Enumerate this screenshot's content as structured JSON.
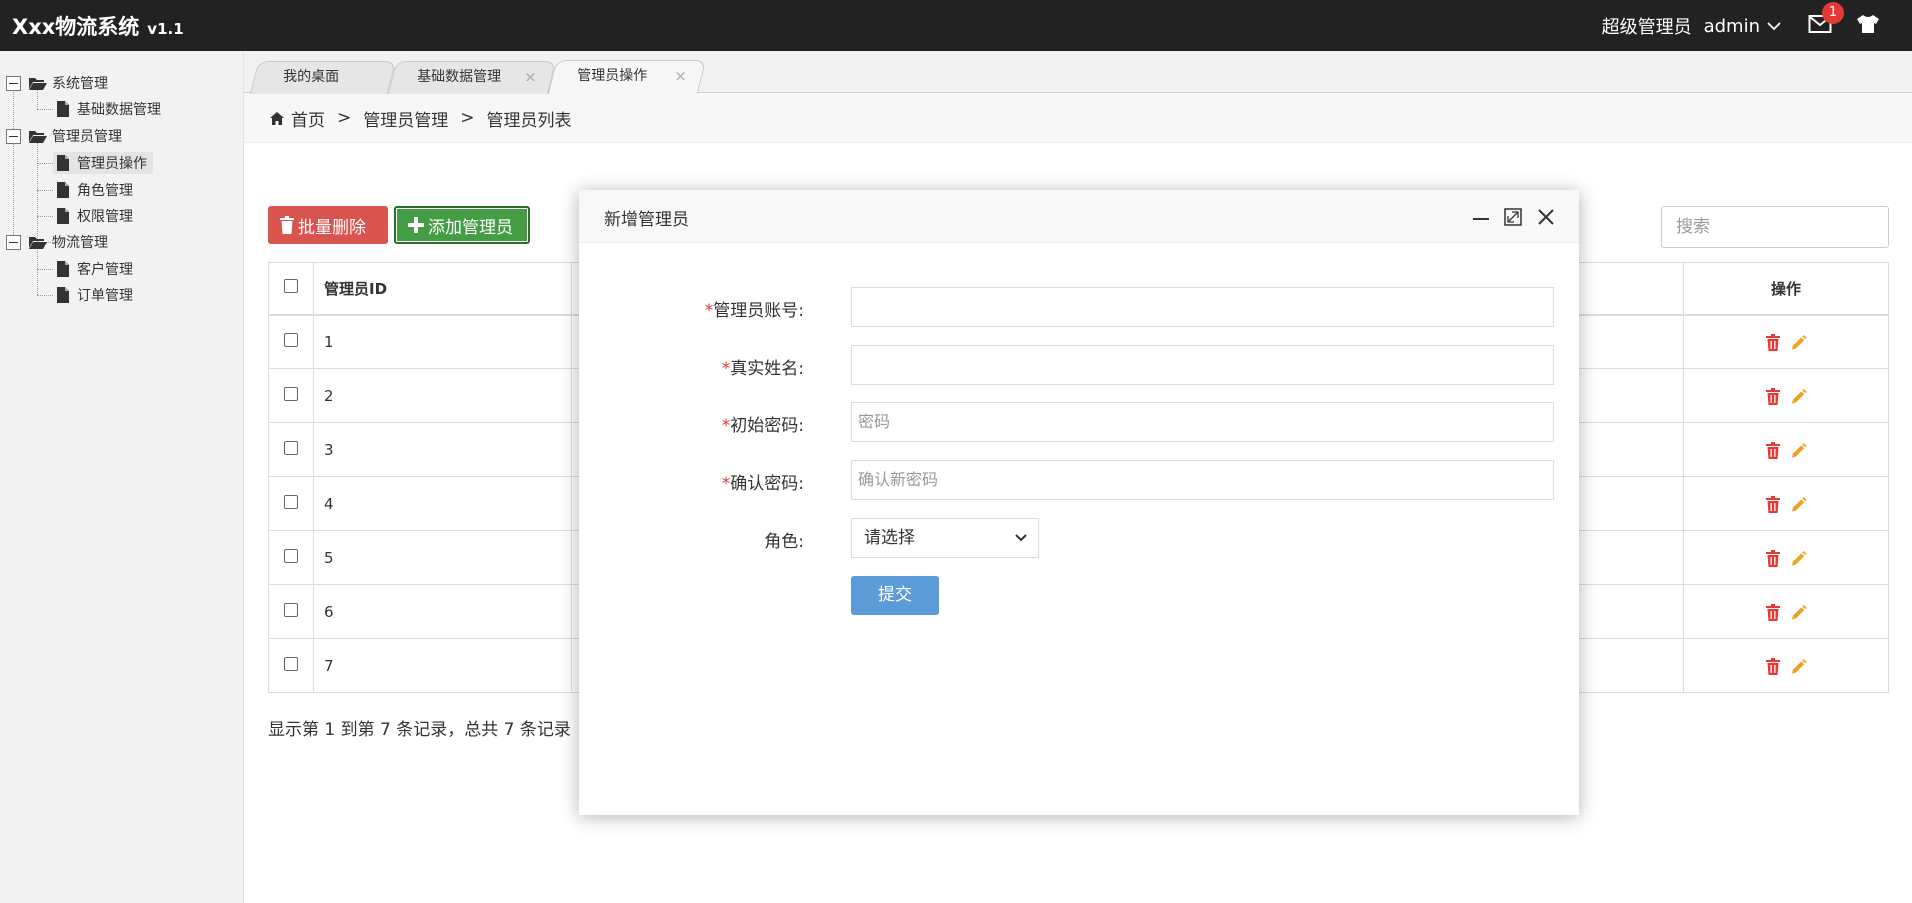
{
  "header": {
    "app_name": "Xxx物流系统",
    "version": "v1.1",
    "role": "超级管理员",
    "username": "admin",
    "mail_badge": "1"
  },
  "sidebar": {
    "groups": [
      {
        "label": "系统管理",
        "items": [
          {
            "label": "基础数据管理"
          }
        ]
      },
      {
        "label": "管理员管理",
        "items": [
          {
            "label": "管理员操作"
          },
          {
            "label": "角色管理"
          },
          {
            "label": "权限管理"
          }
        ]
      },
      {
        "label": "物流管理",
        "items": [
          {
            "label": "客户管理"
          },
          {
            "label": "订单管理"
          }
        ]
      }
    ],
    "selected": "管理员操作"
  },
  "tabs": [
    {
      "label": "我的桌面",
      "closable": false
    },
    {
      "label": "基础数据管理",
      "closable": true
    },
    {
      "label": "管理员操作",
      "closable": true,
      "active": true
    }
  ],
  "breadcrumb": {
    "home": "首页",
    "level1": "管理员管理",
    "level2": "管理员列表",
    "separator": ">"
  },
  "toolbar": {
    "batch_delete_label": "批量删除",
    "add_admin_label": "添加管理员",
    "search_placeholder": "搜索"
  },
  "table": {
    "columns": {
      "id": "管理员ID",
      "ops": "操作"
    },
    "rows": [
      {
        "id": "1"
      },
      {
        "id": "2"
      },
      {
        "id": "3"
      },
      {
        "id": "4"
      },
      {
        "id": "5"
      },
      {
        "id": "6"
      },
      {
        "id": "7"
      }
    ]
  },
  "footer": {
    "summary": "显示第 1 到第 7 条记录，总共 7 条记录"
  },
  "modal": {
    "title": "新增管理员",
    "fields": {
      "account": {
        "label": "管理员账号:",
        "placeholder": ""
      },
      "realname": {
        "label": "真实姓名:",
        "placeholder": ""
      },
      "password": {
        "label": "初始密码:",
        "placeholder": "密码"
      },
      "confirm": {
        "label": "确认密码:",
        "placeholder": "确认新密码"
      },
      "role": {
        "label": "角色:",
        "selected": "请选择"
      }
    },
    "required_mark": "*",
    "submit_label": "提交"
  },
  "colors": {
    "header_bg": "#222222",
    "danger": "#d9534f",
    "success": "#449d44",
    "primary": "#5b9bd8",
    "delete_icon": "#e53935",
    "edit_icon": "#f0a020"
  },
  "icons": {
    "mail": "mail-icon",
    "shirt": "shirt-icon",
    "folder": "folder-open-icon",
    "file": "file-icon",
    "home": "home-icon",
    "trash": "trash-icon",
    "plus": "plus-icon",
    "pencil": "pencil-icon"
  }
}
